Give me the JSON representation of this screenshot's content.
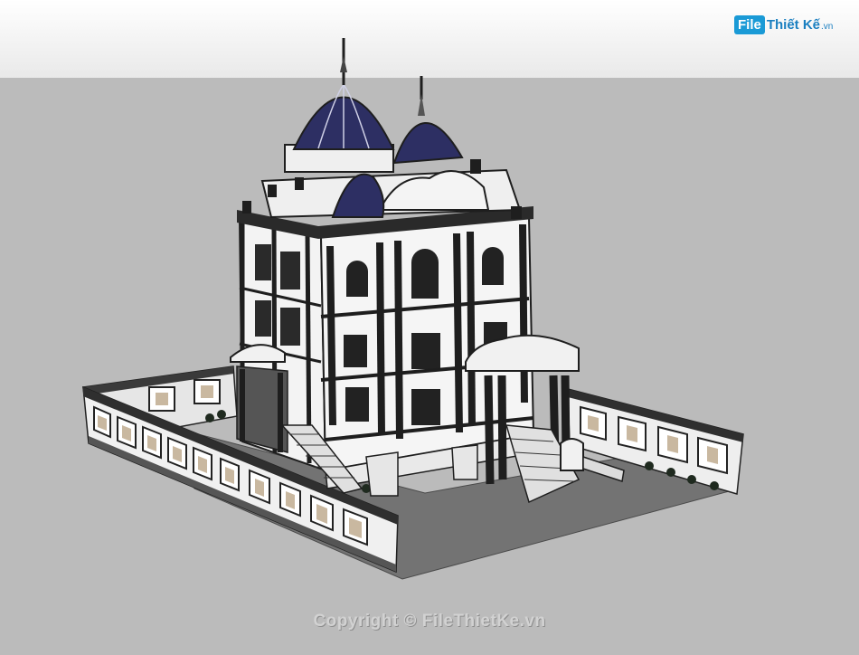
{
  "logo": {
    "badge": "File",
    "name": "Thiết Kế",
    "suffix": ".vn"
  },
  "watermark": "Copyright © FileThietKe.vn",
  "colors": {
    "sky": "#ffffff",
    "ground": "#bbbbbb",
    "dome": "#2d2f63",
    "wall": "#f2f2f2",
    "trim": "#1e1e1e",
    "paving": "#767676"
  }
}
